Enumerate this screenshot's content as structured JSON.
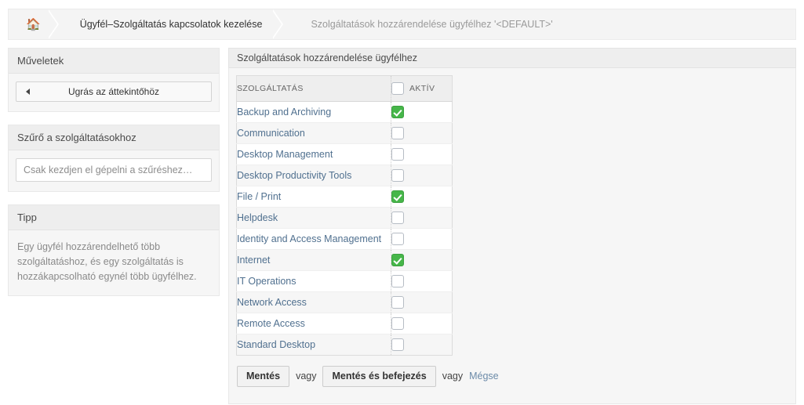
{
  "breadcrumb": {
    "home_icon": "home-icon",
    "items": [
      {
        "label": "Ügyfél–Szolgáltatás kapcsolatok kezelése",
        "state": "active"
      },
      {
        "label": "Szolgáltatások hozzárendelése ügyfélhez '<DEFAULT>'",
        "state": "muted"
      }
    ]
  },
  "sidebar": {
    "actions": {
      "title": "Műveletek",
      "back_button": {
        "label": "Ugrás az áttekintőhöz",
        "icon": "arrow-left-icon"
      }
    },
    "filter": {
      "title": "Szűrő a szolgáltatásokhoz",
      "placeholder": "Csak kezdjen el gépelni a szűréshez…",
      "value": ""
    },
    "tip": {
      "title": "Tipp",
      "text": "Egy ügyfél hozzárendelhető több szolgáltatáshoz, és egy szolgáltatás is hozzákapcsolható egynél több ügyfélhez."
    }
  },
  "main": {
    "title": "Szolgáltatások hozzárendelése ügyfélhez",
    "table": {
      "columns": [
        "SZOLGÁLTATÁS",
        "AKTÍV"
      ],
      "select_all_checked": false,
      "rows": [
        {
          "service": "Backup and Archiving",
          "active": true
        },
        {
          "service": "Communication",
          "active": false
        },
        {
          "service": "Desktop Management",
          "active": false
        },
        {
          "service": "Desktop Productivity Tools",
          "active": false
        },
        {
          "service": "File / Print",
          "active": true
        },
        {
          "service": "Helpdesk",
          "active": false
        },
        {
          "service": "Identity and Access Management",
          "active": false
        },
        {
          "service": "Internet",
          "active": true
        },
        {
          "service": "IT Operations",
          "active": false
        },
        {
          "service": "Network Access",
          "active": false
        },
        {
          "service": "Remote Access",
          "active": false
        },
        {
          "service": "Standard Desktop",
          "active": false
        }
      ]
    },
    "footer": {
      "save_label": "Mentés",
      "or_label_1": "vagy",
      "save_finish_label": "Mentés és befejezés",
      "or_label_2": "vagy",
      "cancel_label": "Mégse"
    }
  },
  "colors": {
    "checkbox_checked": "#46b649",
    "link": "#50708f",
    "panel_header": "#eeeeee"
  }
}
